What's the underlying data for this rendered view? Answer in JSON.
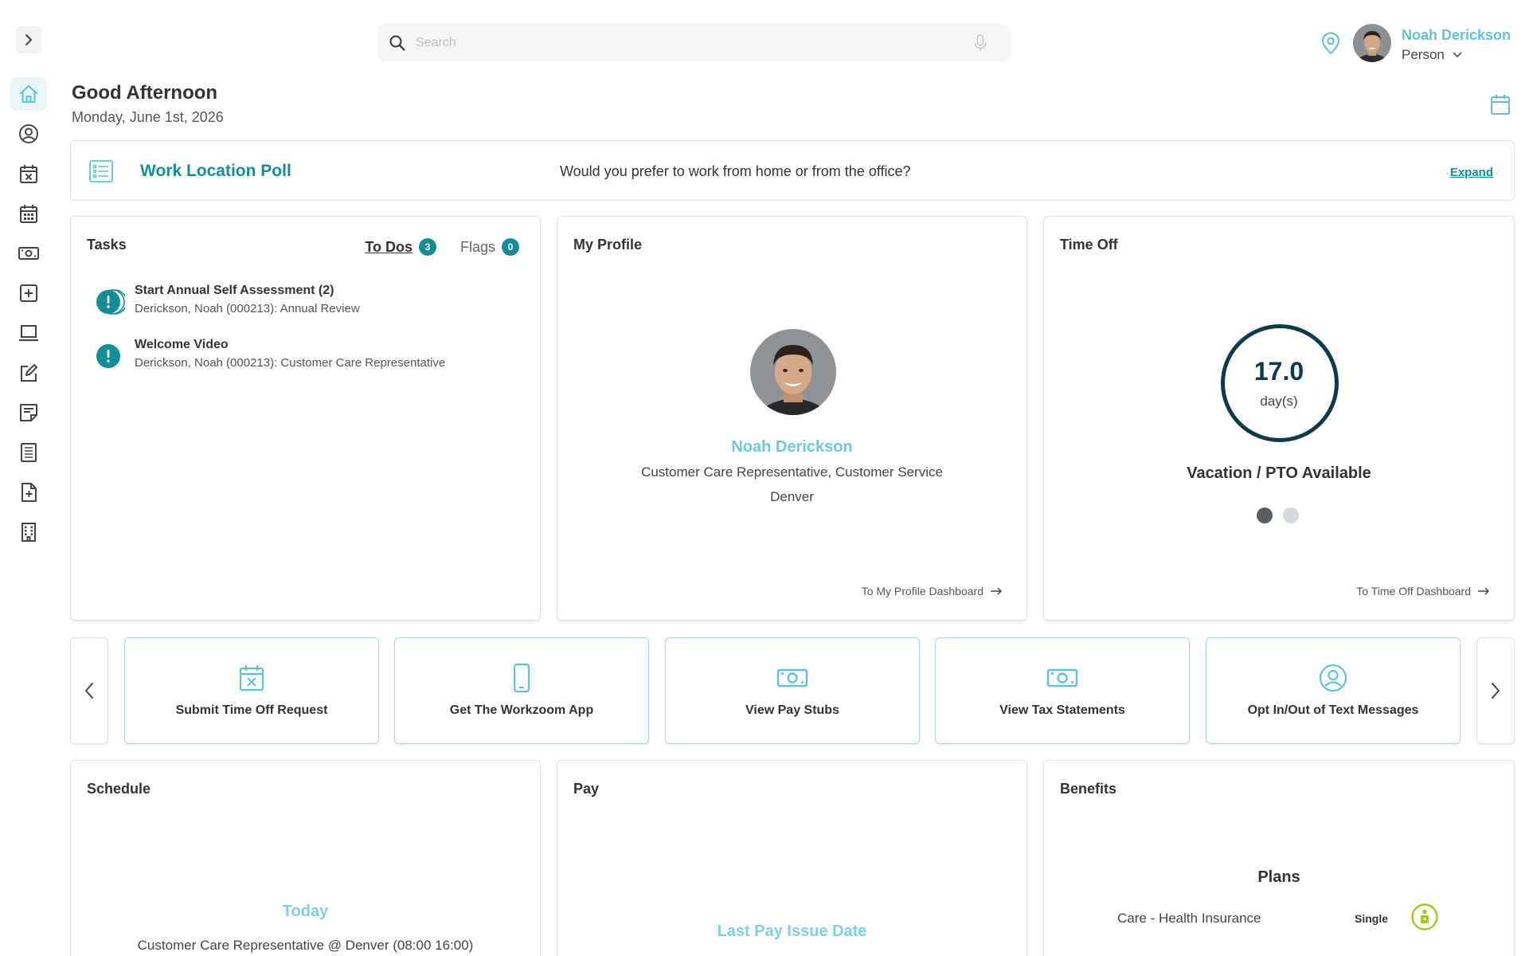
{
  "header": {
    "search_placeholder": "Search",
    "user_name": "Noah Derickson",
    "user_role": "Person"
  },
  "greeting": {
    "title": "Good Afternoon",
    "date": "Monday, June 1st, 2026"
  },
  "poll": {
    "title": "Work Location Poll",
    "question": "Would you prefer to work from home or from the office?",
    "expand_label": "Expand"
  },
  "tasks": {
    "title": "Tasks",
    "tabs": [
      {
        "label": "To Dos",
        "count": "3"
      },
      {
        "label": "Flags",
        "count": "0"
      }
    ],
    "items": [
      {
        "title": "Start Annual Self Assessment (2)",
        "subtitle": "Derickson, Noah (000213): Annual Review"
      },
      {
        "title": "Welcome Video",
        "subtitle": "Derickson, Noah (000213): Customer Care Representative"
      }
    ]
  },
  "profile": {
    "title": "My Profile",
    "name": "Noah Derickson",
    "job": "Customer Care Representative, Customer Service",
    "city": "Denver",
    "link": "To My Profile Dashboard"
  },
  "time_off": {
    "title": "Time Off",
    "value": "17.0",
    "unit": "day(s)",
    "label": "Vacation / PTO Available",
    "link": "To Time Off Dashboard",
    "pages": 2,
    "active_page": 1
  },
  "quick_actions": [
    {
      "label": "Submit Time Off Request",
      "icon": "calendar-x-icon"
    },
    {
      "label": "Get The Workzoom App",
      "icon": "phone-icon"
    },
    {
      "label": "View Pay Stubs",
      "icon": "money-icon"
    },
    {
      "label": "View Tax Statements",
      "icon": "money-icon"
    },
    {
      "label": "Opt In/Out of Text Messages",
      "icon": "user-circle-icon"
    }
  ],
  "schedule": {
    "title": "Schedule",
    "today_label": "Today",
    "shift": "Customer Care Representative @ Denver (08:00 16:00)"
  },
  "pay": {
    "title": "Pay",
    "last_issue_label": "Last Pay Issue Date"
  },
  "benefits": {
    "title": "Benefits",
    "plans_title": "Plans",
    "plans": [
      {
        "name": "Care - Health Insurance",
        "coverage": "Single"
      }
    ]
  },
  "colors": {
    "accent": "#128e96",
    "light_accent": "#5ec3d6",
    "navy": "#0f3a4b",
    "benefit_green": "#9ccc1c"
  }
}
